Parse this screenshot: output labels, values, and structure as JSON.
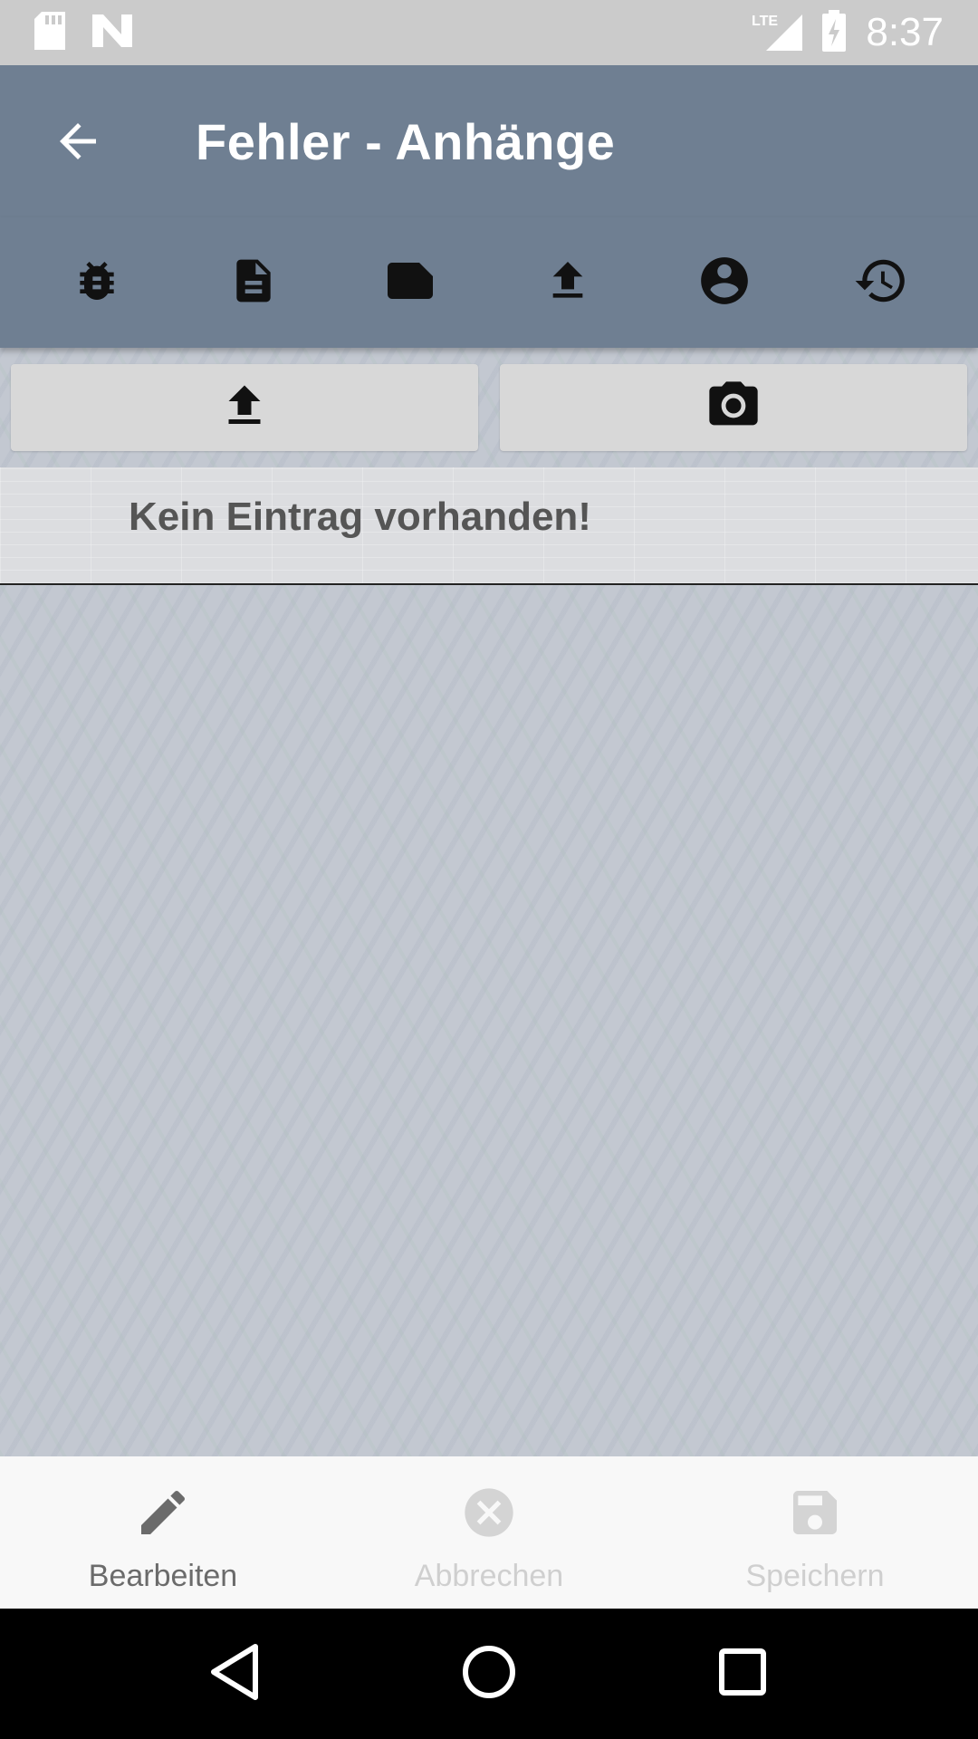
{
  "status_bar": {
    "time": "8:37",
    "network": "LTE",
    "icons": [
      "sd-card-icon",
      "n-icon",
      "lte-signal-icon",
      "battery-charging-icon"
    ]
  },
  "app_bar": {
    "title": "Fehler - Anhänge",
    "back_icon": "arrow-back-icon"
  },
  "tabs": [
    {
      "name": "bug-icon"
    },
    {
      "name": "document-icon"
    },
    {
      "name": "note-icon"
    },
    {
      "name": "upload-icon"
    },
    {
      "name": "account-icon"
    },
    {
      "name": "history-icon"
    }
  ],
  "actions": {
    "upload_icon": "upload-icon",
    "camera_icon": "camera-icon"
  },
  "list": {
    "empty_message": "Kein Eintrag vorhanden!"
  },
  "bottom_bar": {
    "edit_label": "Bearbeiten",
    "cancel_label": "Abbrechen",
    "save_label": "Speichern"
  },
  "colors": {
    "primary": "#6f7f92",
    "status_bar": "#cbcbcb",
    "bottom_bar": "#f8f8f8",
    "disabled_text": "#cfcfcf"
  }
}
